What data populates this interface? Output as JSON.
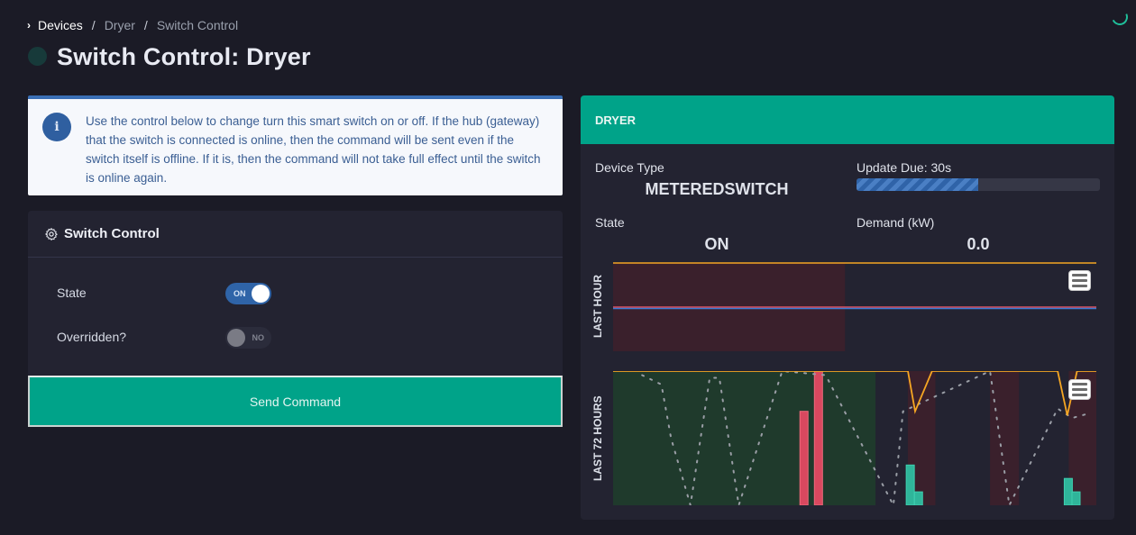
{
  "breadcrumb": {
    "items": [
      {
        "label": "Devices",
        "active": true
      },
      {
        "label": "Dryer",
        "active": false
      },
      {
        "label": "Switch Control",
        "active": false
      }
    ],
    "separator": "/"
  },
  "page": {
    "title": "Switch Control: Dryer",
    "status_dot_color": "#173a3a",
    "loading": true
  },
  "alert": {
    "icon": "info-icon",
    "icon_glyph": "i",
    "text": "Use the control below to change turn this smart switch on or off. If the hub (gateway) that the switch is connected is online, then the command will be sent even if the switch itself is offline. If it is, then the command will not take full effect until the switch is online again."
  },
  "control": {
    "title": "Switch Control",
    "icon": "gear-icon",
    "rows": [
      {
        "label": "State",
        "toggle_label": "ON",
        "value": true
      },
      {
        "label": "Overridden?",
        "toggle_label": "NO",
        "value": false
      }
    ],
    "send_label": "Send Command"
  },
  "device": {
    "name": "DRYER",
    "device_type_label": "Device Type",
    "device_type": "METEREDSWITCH",
    "update_label": "Update Due: 30s",
    "update_progress": 0.5,
    "state_label": "State",
    "state": "ON",
    "demand_label": "Demand (kW)",
    "demand": "0.0",
    "colors": {
      "accent": "#00a389",
      "off_band": "#3a202c",
      "on_band": "#1f3a2c",
      "threshold_line": "#f5a623",
      "demand_line": "#e05263",
      "state_line": "#3a7bd5",
      "bar_high": "#d9485f",
      "bar_energy": "#2fb59a"
    }
  },
  "chart_data": [
    {
      "type": "line",
      "title": "LAST HOUR",
      "x": [
        0,
        1
      ],
      "series": [
        {
          "name": "threshold",
          "values": [
            1,
            1
          ],
          "color": "#f5a623"
        },
        {
          "name": "demand",
          "values": [
            0.5,
            0.5
          ],
          "color": "#e05263"
        },
        {
          "name": "state",
          "values": [
            0.5,
            0.5
          ],
          "color": "#3a7bd5"
        }
      ],
      "bands": [
        {
          "from": 0,
          "to": 0.48,
          "kind": "off"
        }
      ],
      "ylim": [
        0,
        1
      ],
      "grid": false,
      "legend": "none"
    },
    {
      "type": "bar",
      "title": "LAST 72 HOURS",
      "xlim": [
        0,
        1
      ],
      "ylim": [
        0,
        1
      ],
      "bands": [
        {
          "from": 0.0,
          "to": 0.543,
          "kind": "on"
        },
        {
          "from": 0.61,
          "to": 0.667,
          "kind": "off"
        },
        {
          "from": 0.78,
          "to": 0.84,
          "kind": "off"
        },
        {
          "from": 0.943,
          "to": 1.0,
          "kind": "off"
        }
      ],
      "bars": [
        {
          "name": "high",
          "x": 0.395,
          "value": 0.7
        },
        {
          "name": "high",
          "x": 0.425,
          "value": 1.0
        },
        {
          "name": "energy",
          "x": 0.615,
          "value": 0.3
        },
        {
          "name": "energy",
          "x": 0.632,
          "value": 0.1
        },
        {
          "name": "energy",
          "x": 0.942,
          "value": 0.2
        },
        {
          "name": "energy",
          "x": 0.958,
          "value": 0.1
        }
      ],
      "series": [
        {
          "name": "threshold",
          "x": [
            0,
            0.05,
            0.08,
            0.25,
            0.5,
            0.543,
            0.57,
            0.61,
            0.625,
            0.66,
            0.855,
            0.92,
            0.94,
            0.96,
            1.0
          ],
          "values": [
            1,
            1,
            1,
            1,
            1,
            1,
            1,
            1,
            0.7,
            1,
            1,
            1,
            0.67,
            1,
            1
          ]
        },
        {
          "name": "temperature",
          "x": [
            0.06,
            0.1,
            0.12,
            0.16,
            0.2,
            0.22,
            0.26,
            0.35,
            0.44,
            0.58,
            0.6,
            0.78,
            0.82,
            0.92,
            0.95,
            0.98
          ],
          "values": [
            0.97,
            0.9,
            0.5,
            0.0,
            0.95,
            0.95,
            0.0,
            1.0,
            0.97,
            0.0,
            0.7,
            1.0,
            0.0,
            0.72,
            0.65,
            0.68
          ]
        }
      ],
      "grid": false,
      "legend": "none"
    }
  ]
}
